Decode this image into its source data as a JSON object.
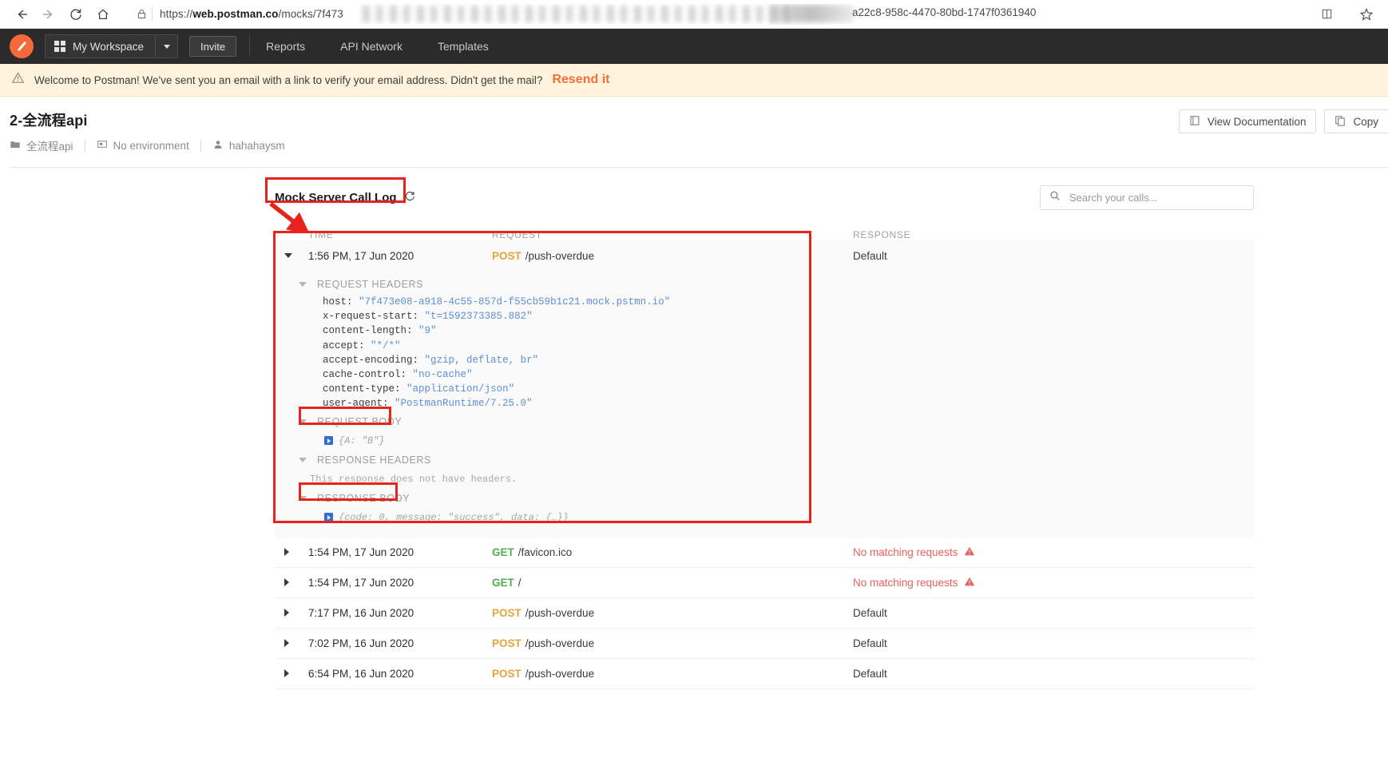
{
  "browser": {
    "url_prefix": "https://",
    "url_domain": "web.postman.co",
    "url_path": "/mocks/7f473",
    "url_tail": "a22c8-958c-4470-80bd-1747f0361940",
    "back_icon": "back-arrow-icon",
    "forward_icon": "forward-arrow-icon",
    "refresh_icon": "refresh-icon",
    "home_icon": "home-icon",
    "lock_icon": "lock-icon",
    "reading_icon": "reading-view-icon",
    "favorite_icon": "star-icon"
  },
  "navbar": {
    "logo": "postman-logo-icon",
    "workspace": "My Workspace",
    "workspace_icon": "grid-icon",
    "caret_icon": "chevron-down-icon",
    "invite": "Invite",
    "links": [
      "Reports",
      "API Network",
      "Templates"
    ]
  },
  "banner": {
    "icon": "warning-triangle-icon",
    "text": "Welcome to Postman! We've sent you an email with a link to verify your email address. Didn't get the mail?",
    "link": "Resend it"
  },
  "page": {
    "title": "2-全流程api",
    "breadcrumb": {
      "collection_icon": "folder-icon",
      "collection": "全流程api",
      "environment_icon": "monitor-icon",
      "environment": "No environment",
      "user_icon": "person-icon",
      "user": "hahahaysm"
    },
    "actions": [
      {
        "label": "View Documentation",
        "icon": "document-icon"
      },
      {
        "label": "Copy",
        "icon": "copy-icon"
      }
    ]
  },
  "call_log": {
    "title": "Mock Server Call Log",
    "refresh_icon": "refresh-icon",
    "search_placeholder": "Search your calls...",
    "search_value": "",
    "search_icon": "search-icon",
    "columns": [
      "TIME",
      "REQUEST",
      "RESPONSE"
    ],
    "rows": [
      {
        "time": "1:56 PM, 17 Jun 2020",
        "method": "POST",
        "path": "/push-overdue",
        "response": "Default",
        "response_state": "default",
        "expanded": true
      },
      {
        "time": "1:54 PM, 17 Jun 2020",
        "method": "GET",
        "path": "/favicon.ico",
        "response": "No matching requests",
        "response_state": "nomatch",
        "expanded": false
      },
      {
        "time": "1:54 PM, 17 Jun 2020",
        "method": "GET",
        "path": "/",
        "response": "No matching requests",
        "response_state": "nomatch",
        "expanded": false
      },
      {
        "time": "7:17 PM, 16 Jun 2020",
        "method": "POST",
        "path": "/push-overdue",
        "response": "Default",
        "response_state": "default",
        "expanded": false
      },
      {
        "time": "7:02 PM, 16 Jun 2020",
        "method": "POST",
        "path": "/push-overdue",
        "response": "Default",
        "response_state": "default",
        "expanded": false
      },
      {
        "time": "6:54 PM, 16 Jun 2020",
        "method": "POST",
        "path": "/push-overdue",
        "response": "Default",
        "response_state": "default",
        "expanded": false
      }
    ],
    "detail": {
      "request_headers_label": "REQUEST HEADERS",
      "request_headers": [
        {
          "key": "host:",
          "value": "\"7f473e08-a918-4c55-857d-f55cb59b1c21.mock.pstmn.io\""
        },
        {
          "key": "x-request-start:",
          "value": "\"t=1592373385.882\""
        },
        {
          "key": "content-length:",
          "value": "\"9\""
        },
        {
          "key": "accept:",
          "value": "\"*/*\""
        },
        {
          "key": "accept-encoding:",
          "value": "\"gzip, deflate, br\""
        },
        {
          "key": "cache-control:",
          "value": "\"no-cache\""
        },
        {
          "key": "content-type:",
          "value": "\"application/json\""
        },
        {
          "key": "user-agent:",
          "value": "\"PostmanRuntime/7.25.0\""
        }
      ],
      "request_body_label": "REQUEST BODY",
      "request_body": "{A: \"B\"}",
      "response_headers_label": "RESPONSE HEADERS",
      "response_headers_note": "This response does not have headers.",
      "response_body_label": "RESPONSE BODY",
      "response_body": "{code: 0, message: \"success\", data: {…}}"
    }
  },
  "colors": {
    "accent": "#f5693a",
    "annotation": "#e8221c",
    "post": "#e8a33d",
    "get": "#4caf50",
    "error": "#e8615a"
  }
}
